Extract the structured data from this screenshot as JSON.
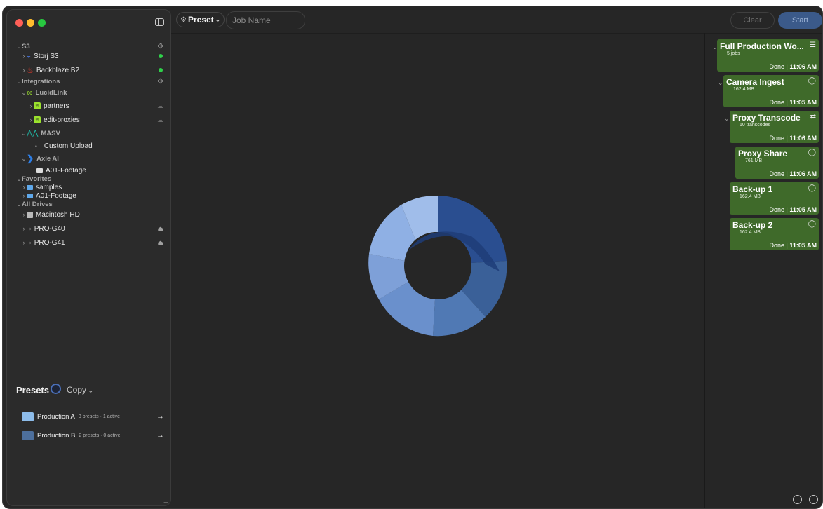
{
  "toolbar": {
    "preset_label": "Preset",
    "job_name_placeholder": "Job Name",
    "clear_label": "Clear",
    "start_label": "Start"
  },
  "sidebar": {
    "s3_section": "S3",
    "storj": "Storj S3",
    "backblaze": "Backblaze B2",
    "integrations_section": "Integrations",
    "lucidlink": "LucidLink",
    "partners": "partners",
    "edit_proxies": "edit-proxies",
    "masv": "MASV",
    "custom_upload": "Custom Upload",
    "axle_ai": "Axle AI",
    "a01_footage_axle": "A01-Footage",
    "favorites_section": "Favorites",
    "samples": "samples",
    "a01_footage_fav": "A01-Footage",
    "all_drives_section": "All Drives",
    "macintosh_hd": "Macintosh HD",
    "pro_g40": "PRO-G40",
    "pro_g41": "PRO-G41",
    "status_color": "#2fd04a"
  },
  "presets": {
    "title": "Presets",
    "copy_label": "Copy",
    "items": [
      {
        "name": "Production A",
        "meta": "3 presets · 1 active"
      },
      {
        "name": "Production B",
        "meta": "2 presets · 0 active"
      }
    ]
  },
  "jobs": [
    {
      "title": "Full Production Wo...",
      "sub": "5 jobs",
      "status": "Done",
      "time": "11:06 AM"
    },
    {
      "title": "Camera Ingest",
      "sub": "162.4 MB",
      "status": "Done",
      "time": "11:05 AM"
    },
    {
      "title": "Proxy Transcode",
      "sub": "10 transcodes",
      "status": "Done",
      "time": "11:06 AM"
    },
    {
      "title": "Proxy Share",
      "sub": "761 MB",
      "status": "Done",
      "time": "11:06 AM"
    },
    {
      "title": "Back-up 1",
      "sub": "162.4 MB",
      "status": "Done",
      "time": "11:05 AM"
    },
    {
      "title": "Back-up 2",
      "sub": "162.4 MB",
      "status": "Done",
      "time": "11:05 AM"
    }
  ],
  "colors": {
    "job_done_bg": "#3f6a2a",
    "accent_blue": "#3b5a8a"
  }
}
